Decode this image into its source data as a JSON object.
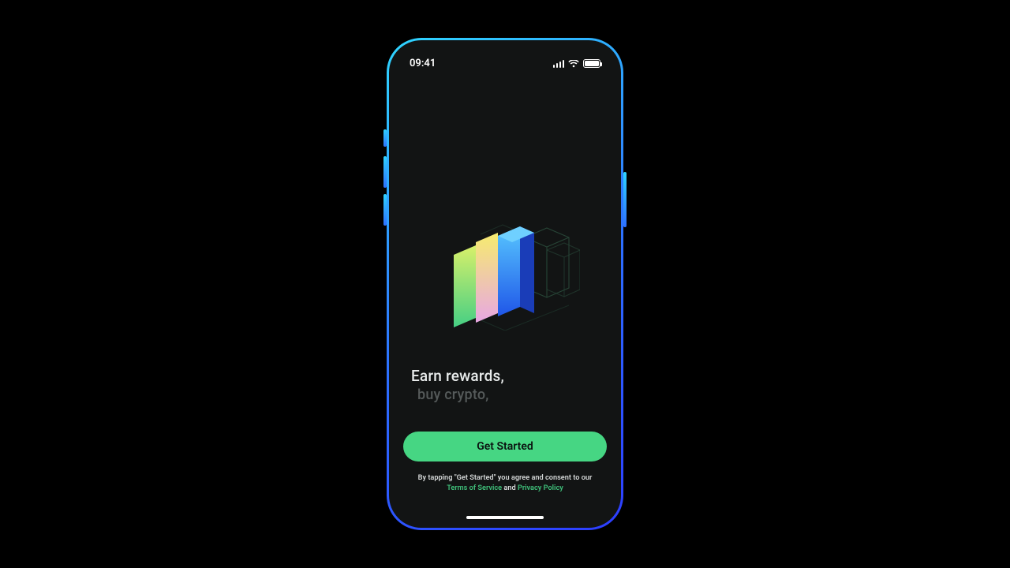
{
  "status": {
    "time": "09:41"
  },
  "hero": {
    "tagline_primary": "Earn rewards,",
    "tagline_secondary": "buy crypto,"
  },
  "cta": {
    "label": "Get Started"
  },
  "legal": {
    "prefix": "By tapping \"Get Started\" you agree and consent to our",
    "terms_label": "Terms of Service",
    "joiner": "and",
    "privacy_label": "Privacy Policy"
  }
}
